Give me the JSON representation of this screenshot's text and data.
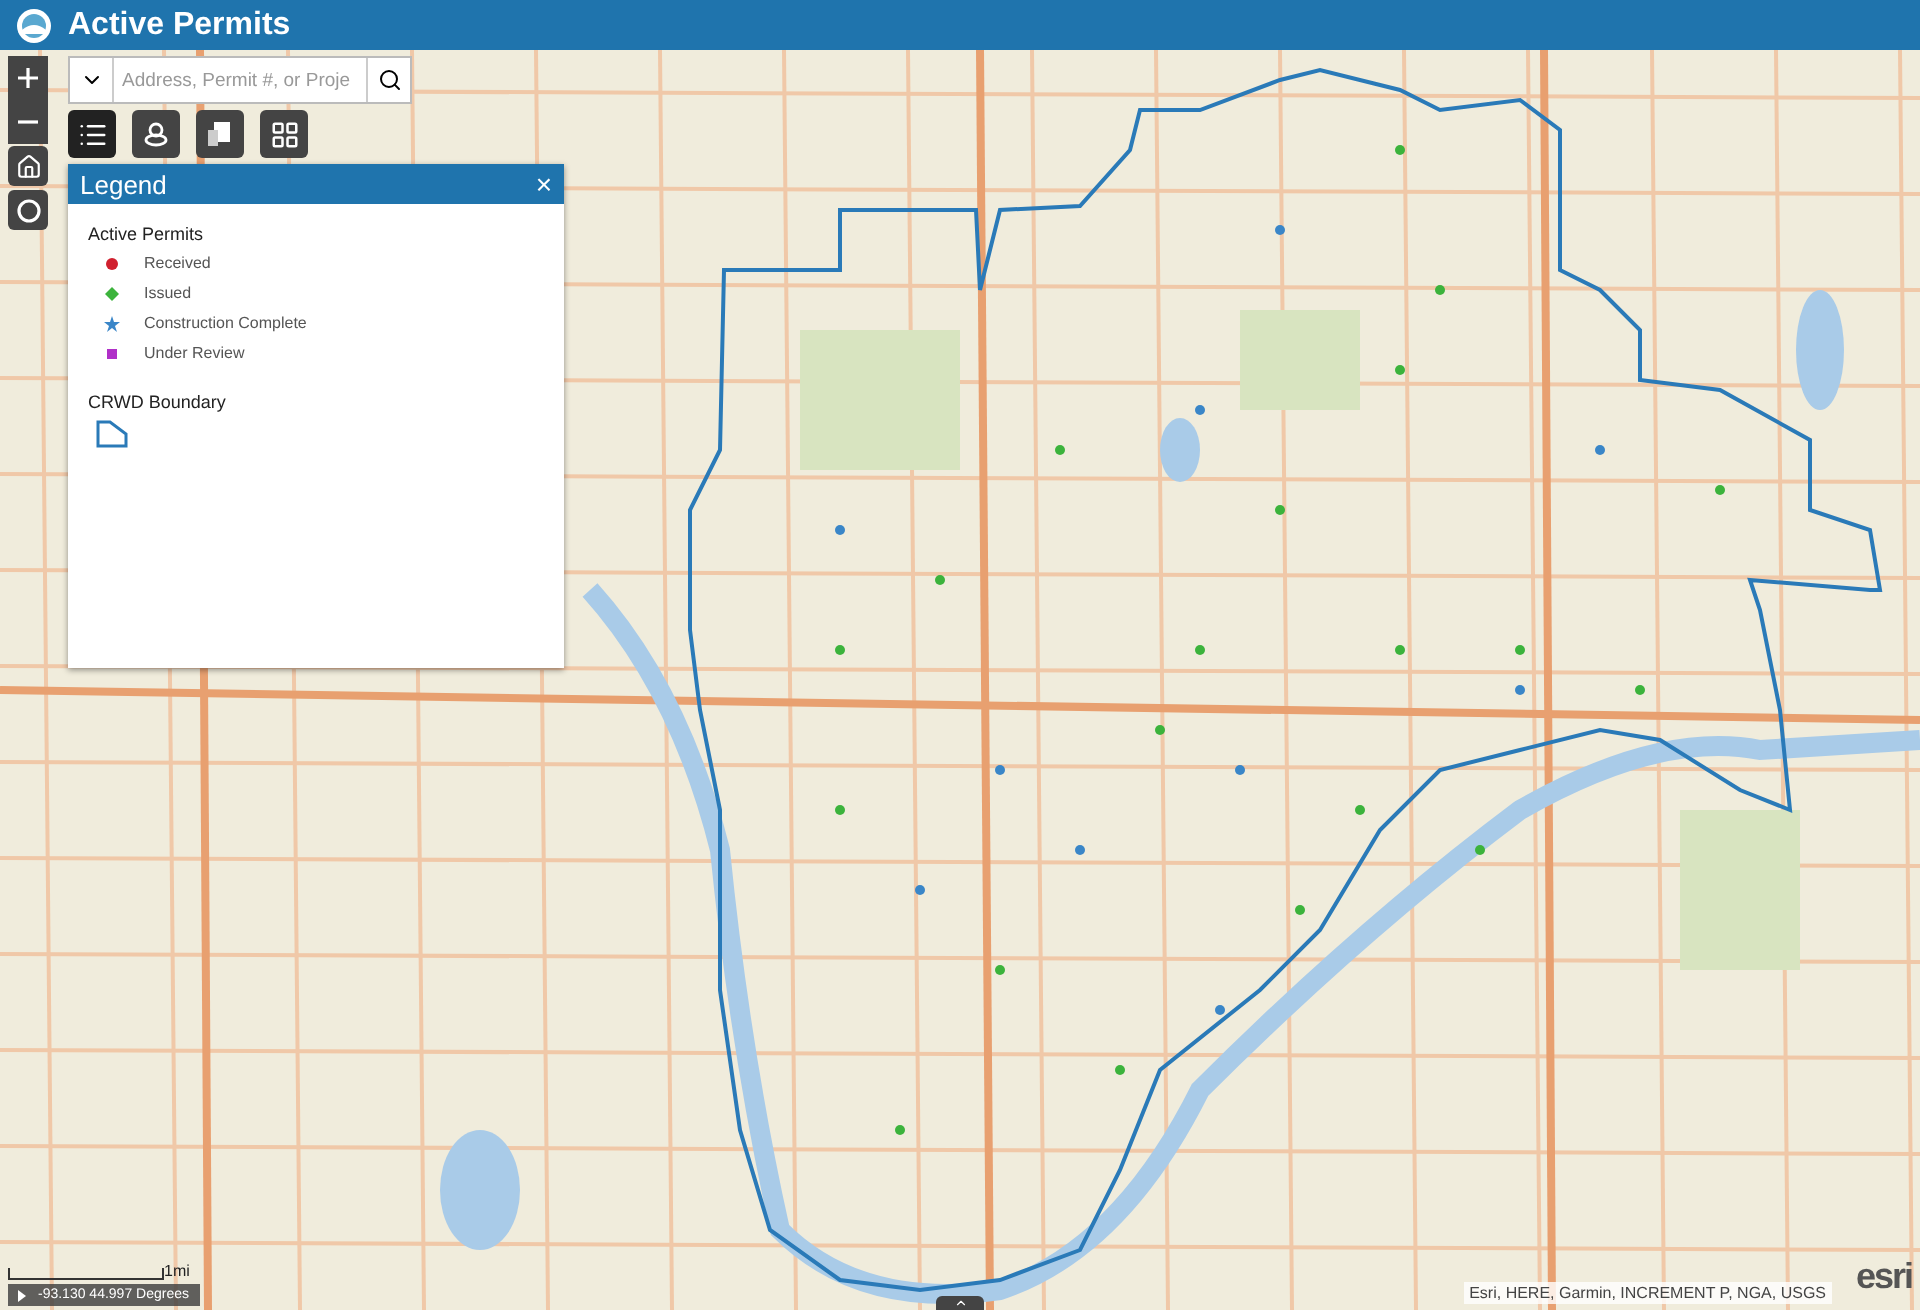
{
  "app": {
    "title": "Active Permits"
  },
  "search": {
    "placeholder": "Address, Permit #, or Proje"
  },
  "legend": {
    "title": "Legend",
    "close": "×",
    "layers": [
      {
        "title": "Active Permits",
        "kind": "points",
        "items": [
          {
            "label": "Received",
            "kind": "circle",
            "color": "#d0202e"
          },
          {
            "label": "Issued",
            "kind": "diamond",
            "color": "#3cb33c"
          },
          {
            "label": "Construction Complete",
            "kind": "star",
            "color": "#3a86c8"
          },
          {
            "label": "Under Review",
            "kind": "square",
            "color": "#b030c8"
          }
        ]
      },
      {
        "title": "CRWD Boundary",
        "kind": "polygon"
      }
    ]
  },
  "scale": {
    "label": "1mi"
  },
  "coordinates": {
    "text": "-93.130 44.997 Degrees"
  },
  "attribution": {
    "text": "Esri, HERE, Garmin, INCREMENT P, NGA, USGS",
    "logo": "esri"
  }
}
